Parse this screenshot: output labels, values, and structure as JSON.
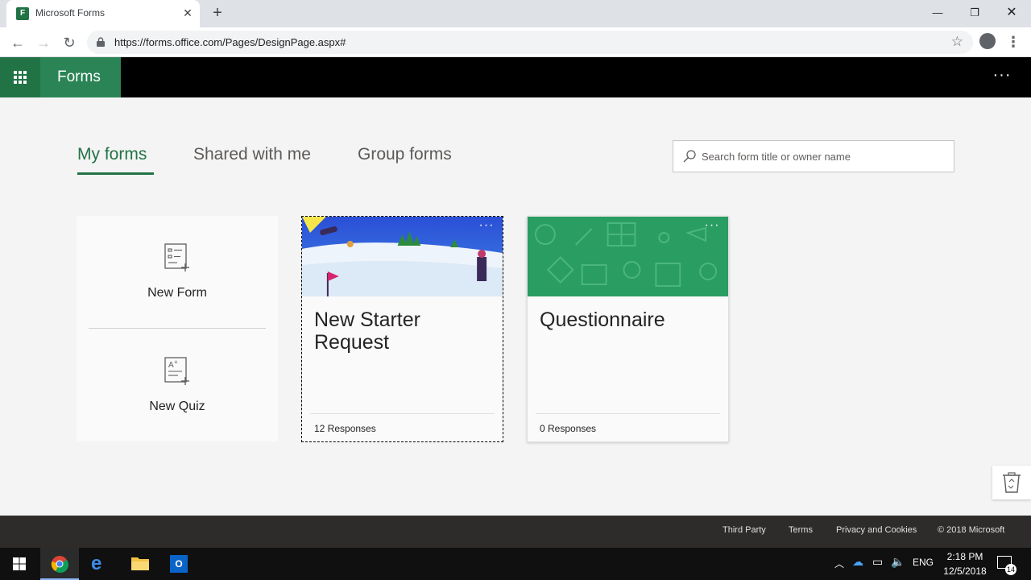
{
  "browser": {
    "tab_title": "Microsoft Forms",
    "tab_favicon_letter": "F",
    "url": "https://forms.office.com/Pages/DesignPage.aspx#",
    "icons": {
      "back": "back-arrow-icon",
      "forward": "forward-arrow-icon",
      "reload": "reload-icon",
      "lock": "lock-icon",
      "bookmark": "star-icon",
      "profile": "profile-icon",
      "menu": "kebab-menu-icon"
    }
  },
  "app": {
    "name": "Forms",
    "accent_color": "#217346",
    "header_color": "#000000"
  },
  "pivots": [
    {
      "label": "My forms",
      "selected": true
    },
    {
      "label": "Shared with me",
      "selected": false
    },
    {
      "label": "Group forms",
      "selected": false
    }
  ],
  "search": {
    "placeholder": "Search form title or owner name",
    "value": ""
  },
  "new_actions": [
    {
      "label": "New Form",
      "icon": "new-form-icon"
    },
    {
      "label": "New Quiz",
      "icon": "new-quiz-icon"
    }
  ],
  "forms": [
    {
      "title": "New Starter Request",
      "responses": "12 Responses",
      "theme": "snow-scene"
    },
    {
      "title": "Questionnaire",
      "responses": "0 Responses",
      "theme": "green-pattern",
      "theme_color": "#2a9d62"
    }
  ],
  "footer": {
    "links": [
      "Third Party",
      "Terms",
      "Privacy and Cookies"
    ],
    "copyright": "© 2018 Microsoft"
  },
  "taskbar": {
    "language": "ENG",
    "time": "2:18 PM",
    "date": "12/5/2018",
    "notifications": "14"
  }
}
